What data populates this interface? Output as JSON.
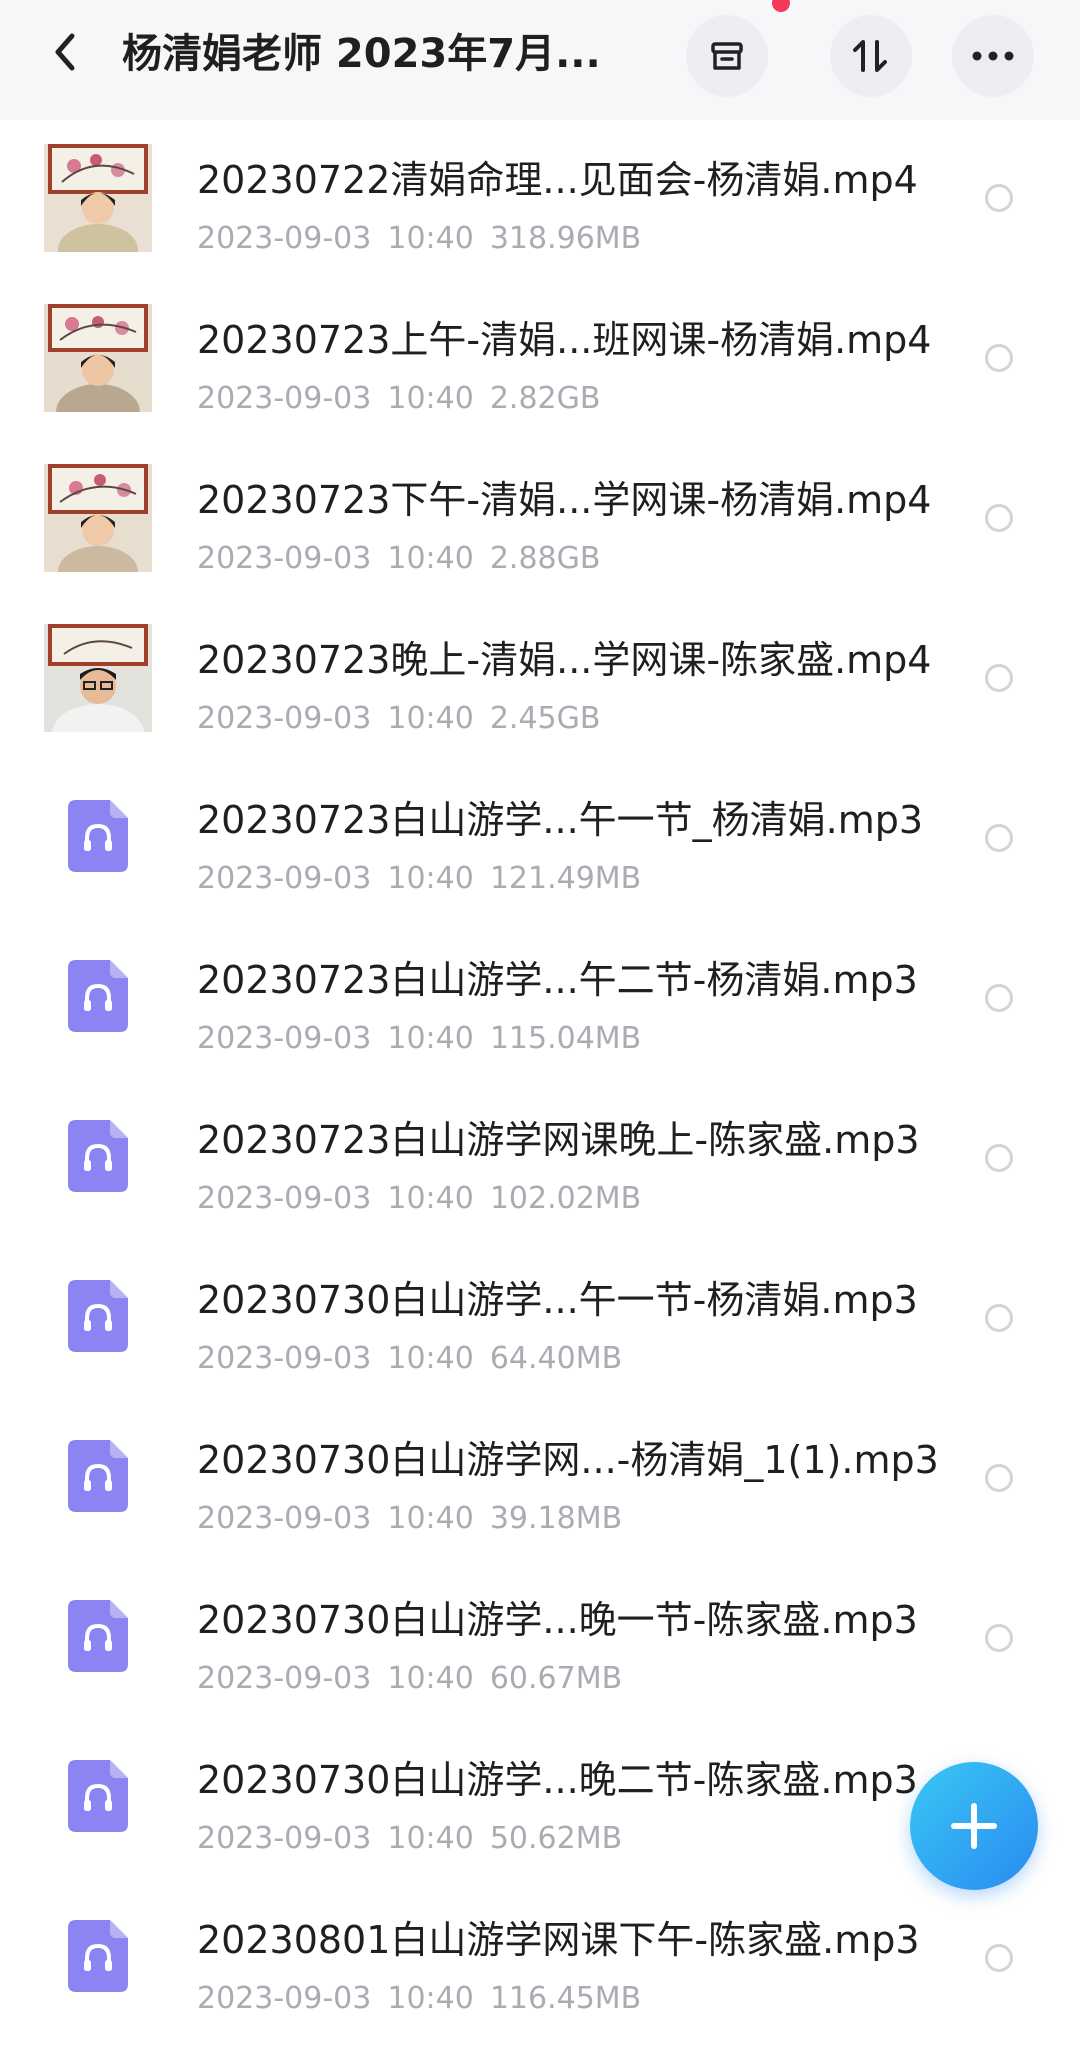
{
  "header": {
    "title": "杨清娟老师 2023年7月...",
    "icons": {
      "back": "chevron-left-icon",
      "archive": "archive-box-icon",
      "sort": "sort-icon",
      "more": "more-horizontal-icon"
    }
  },
  "files": [
    {
      "name": "20230722清娟命理...见面会-杨清娟.mp4",
      "date": "2023-09-03",
      "time": "10:40",
      "size": "318.96MB",
      "type": "video"
    },
    {
      "name": "20230723上午-清娟...班网课-杨清娟.mp4",
      "date": "2023-09-03",
      "time": "10:40",
      "size": "2.82GB",
      "type": "video"
    },
    {
      "name": "20230723下午-清娟...学网课-杨清娟.mp4",
      "date": "2023-09-03",
      "time": "10:40",
      "size": "2.88GB",
      "type": "video"
    },
    {
      "name": "20230723晚上-清娟...学网课-陈家盛.mp4",
      "date": "2023-09-03",
      "time": "10:40",
      "size": "2.45GB",
      "type": "video"
    },
    {
      "name": "20230723白山游学...午一节_杨清娟.mp3",
      "date": "2023-09-03",
      "time": "10:40",
      "size": "121.49MB",
      "type": "audio"
    },
    {
      "name": "20230723白山游学...午二节-杨清娟.mp3",
      "date": "2023-09-03",
      "time": "10:40",
      "size": "115.04MB",
      "type": "audio"
    },
    {
      "name": "20230723白山游学网课晚上-陈家盛.mp3",
      "date": "2023-09-03",
      "time": "10:40",
      "size": "102.02MB",
      "type": "audio"
    },
    {
      "name": "20230730白山游学...午一节-杨清娟.mp3",
      "date": "2023-09-03",
      "time": "10:40",
      "size": "64.40MB",
      "type": "audio"
    },
    {
      "name": "20230730白山游学网...-杨清娟_1(1).mp3",
      "date": "2023-09-03",
      "time": "10:40",
      "size": "39.18MB",
      "type": "audio"
    },
    {
      "name": "20230730白山游学...晚一节-陈家盛.mp3",
      "date": "2023-09-03",
      "time": "10:40",
      "size": "60.67MB",
      "type": "audio"
    },
    {
      "name": "20230730白山游学...晚二节-陈家盛.mp3",
      "date": "2023-09-03",
      "time": "10:40",
      "size": "50.62MB",
      "type": "audio"
    },
    {
      "name": "20230801白山游学网课下午-陈家盛.mp3",
      "date": "2023-09-03",
      "time": "10:40",
      "size": "116.45MB",
      "type": "audio"
    }
  ],
  "fab": {
    "icon": "plus-icon"
  },
  "colors": {
    "accent": "#2a8af0",
    "audio_icon": "#8b84f2",
    "notification_dot": "#f2395b"
  }
}
